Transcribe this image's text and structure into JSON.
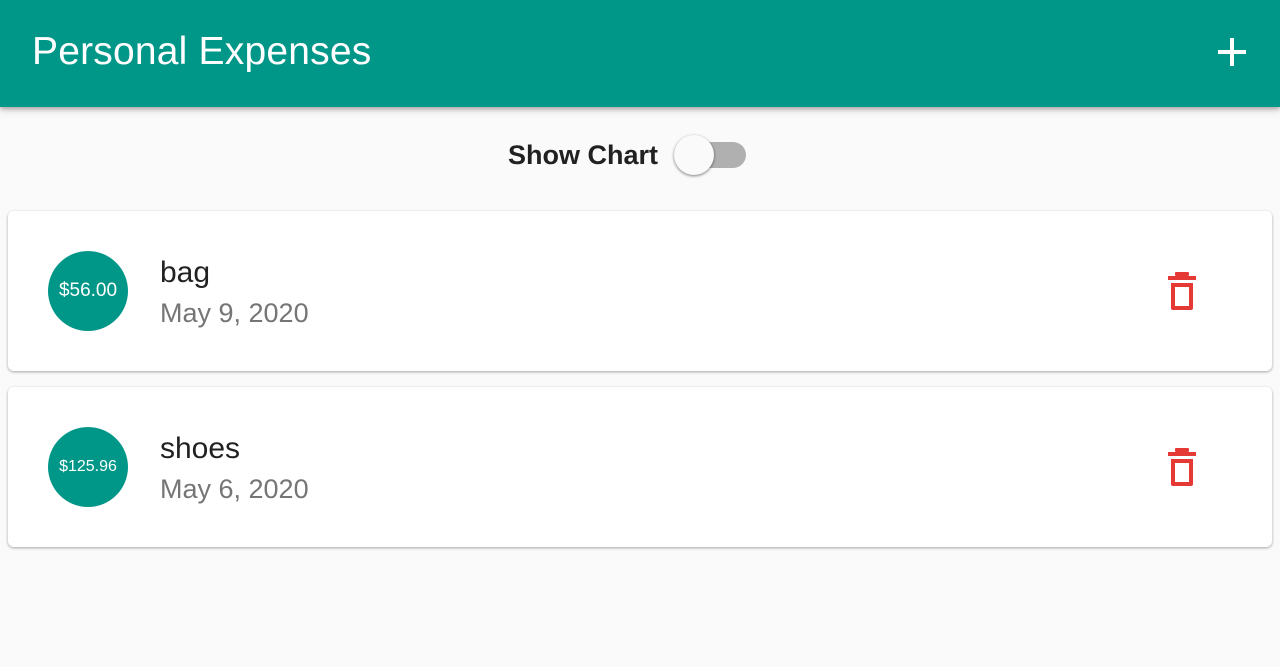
{
  "appbar": {
    "title": "Personal Expenses",
    "add_icon": "plus-icon",
    "color": "#009688"
  },
  "chart_toggle": {
    "label": "Show Chart",
    "enabled": false
  },
  "transactions": [
    {
      "amount": "$56.00",
      "title": "bag",
      "date": "May 9, 2020",
      "delete_icon": "trash-icon"
    },
    {
      "amount": "$125.96",
      "title": "shoes",
      "date": "May 6, 2020",
      "delete_icon": "trash-icon"
    }
  ],
  "colors": {
    "primary": "#009688",
    "delete": "#e53935",
    "background": "#fafafa"
  }
}
